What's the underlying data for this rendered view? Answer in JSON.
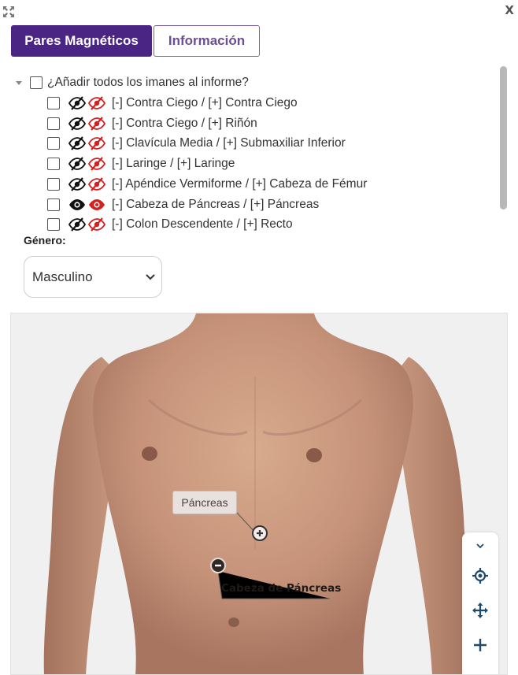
{
  "window": {
    "close_label": "X",
    "expand_icon": "expand-arrows-icon"
  },
  "tabs": [
    {
      "label": "Pares Magnéticos",
      "active": true
    },
    {
      "label": "Información",
      "active": false
    }
  ],
  "tree": {
    "root_label": "¿Añadir todos los imanes al informe?",
    "rows": [
      {
        "label": "[-] Contra Ciego / [+] Contra Ciego",
        "visible": false
      },
      {
        "label": "[-] Contra Ciego / [+] Riñón",
        "visible": false
      },
      {
        "label": "[-] Clavícula Media / [+] Submaxiliar Inferior",
        "visible": false
      },
      {
        "label": "[-] Laringe / [+] Laringe",
        "visible": false
      },
      {
        "label": "[-] Apéndice Vermiforme / [+] Cabeza de Fémur",
        "visible": false
      },
      {
        "label": "[-] Cabeza de Páncreas / [+] Páncreas",
        "visible": true
      },
      {
        "label": "[-] Colon Descendente / [+] Recto",
        "visible": false
      }
    ]
  },
  "gender": {
    "label": "Género:",
    "selected": "Masculino"
  },
  "viewer": {
    "positive_magnet_label": "Páncreas",
    "negative_magnet_label": "Cabeza de Páncreas",
    "controls": [
      "chevron-down-icon",
      "locate-target-icon",
      "move-arrows-icon",
      "zoom-in-plus-icon"
    ]
  },
  "colors": {
    "accent": "#4b2583",
    "eye_red": "#d42020",
    "skin": "#c99a7f"
  }
}
